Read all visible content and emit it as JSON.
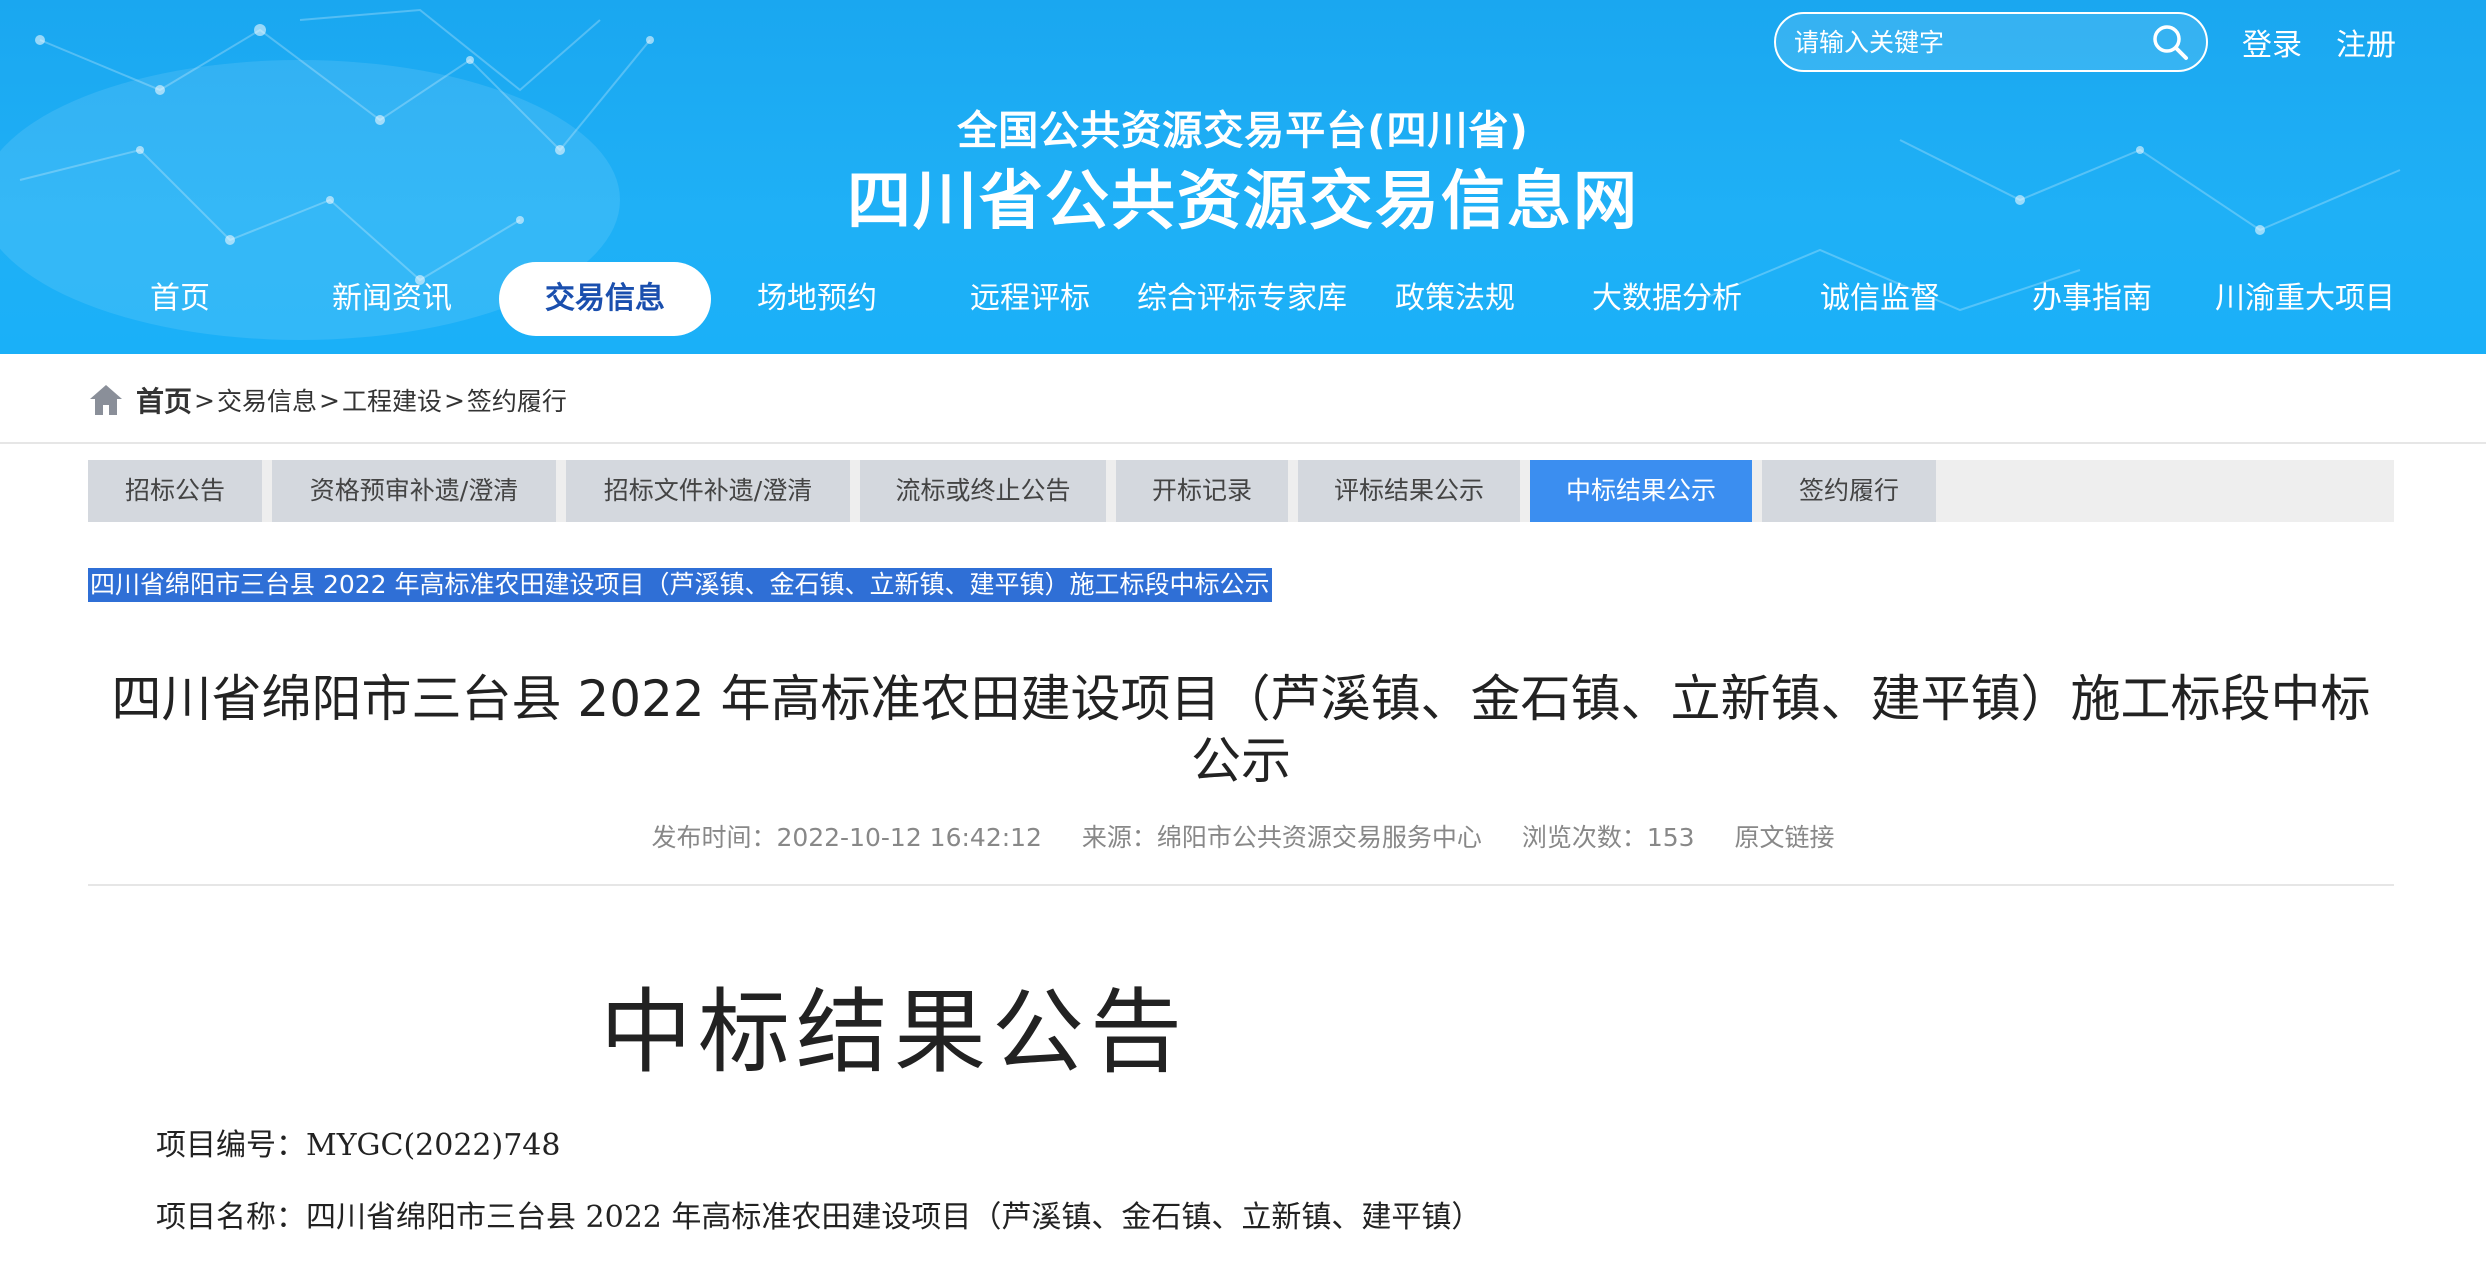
{
  "header": {
    "search_placeholder": "请输入关键字",
    "login": "登录",
    "register": "注册",
    "subtitle": "全国公共资源交易平台(四川省)",
    "title": "四川省公共资源交易信息网"
  },
  "nav": {
    "items": [
      "首页",
      "新闻资讯",
      "交易信息",
      "场地预约",
      "远程评标",
      "综合评标专家库",
      "政策法规",
      "大数据分析",
      "诚信监督",
      "办事指南",
      "川渝重大项目"
    ],
    "active_index": 2
  },
  "breadcrumb": {
    "home": "首页",
    "sep": ">",
    "items": [
      "交易信息",
      "工程建设",
      "签约履行"
    ]
  },
  "tabs": {
    "items": [
      "招标公告",
      "资格预审补遗/澄清",
      "招标文件补遗/澄清",
      "流标或终止公告",
      "开标记录",
      "评标结果公示",
      "中标结果公示",
      "签约履行"
    ],
    "active_index": 6
  },
  "selected_title": "四川省绵阳市三台县 2022 年高标准农田建设项目（芦溪镇、金石镇、立新镇、建平镇）施工标段中标公示",
  "article": {
    "title_line1": "四川省绵阳市三台县 2022 年高标准农田建设项目（芦溪镇、金石镇、立新镇、建平镇）施工标段中标",
    "title_line2": "公示",
    "meta": {
      "publish_time": "发布时间：2022-10-12 16:42:12",
      "source": "来源：绵阳市公共资源交易服务中心",
      "views": "浏览次数：153",
      "original_link": "原文链接"
    },
    "doc_heading": "中标结果公告",
    "project_no": "项目编号：MYGC(2022)748",
    "project_name": "项目名称：四川省绵阳市三台县 2022 年高标准农田建设项目（芦溪镇、金石镇、立新镇、建平镇）"
  },
  "colors": {
    "header_blue": "#1fb0f6",
    "nav_active_text": "#1a4fae",
    "tab_active": "#3b8ef0",
    "selection": "#2f6fd6"
  }
}
